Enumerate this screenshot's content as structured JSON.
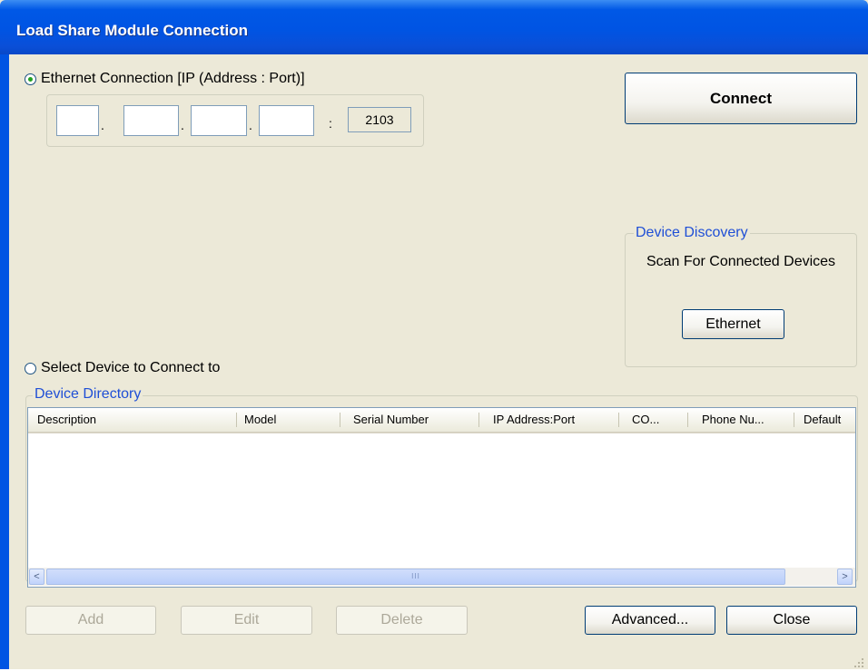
{
  "window": {
    "title": "Load Share Module Connection"
  },
  "ethernet": {
    "radio_label": "Ethernet Connection [IP (Address : Port)]",
    "selected": true,
    "ip": [
      "",
      "",
      "",
      ""
    ],
    "ip_sep": ".",
    "port_sep": ":",
    "port": "2103"
  },
  "connect_button": "Connect",
  "discovery": {
    "legend": "Device Discovery",
    "caption": "Scan For Connected Devices",
    "ethernet_button": "Ethernet"
  },
  "select_device": {
    "radio_label": "Select Device to Connect to",
    "selected": false
  },
  "directory": {
    "legend": "Device Directory",
    "columns": [
      "Description",
      "Model",
      "Serial Number",
      "IP Address:Port",
      "CO...",
      "Phone Nu...",
      "Default"
    ],
    "rows": [],
    "scroll_left": "<",
    "scroll_right": ">",
    "thumb_grip": "III"
  },
  "buttons": {
    "add": "Add",
    "edit": "Edit",
    "delete": "Delete",
    "advanced": "Advanced...",
    "close": "Close"
  },
  "colors": {
    "title_bar": "#0054e3",
    "legend_text": "#1f4fd6",
    "dialog_bg": "#ece9d8"
  }
}
